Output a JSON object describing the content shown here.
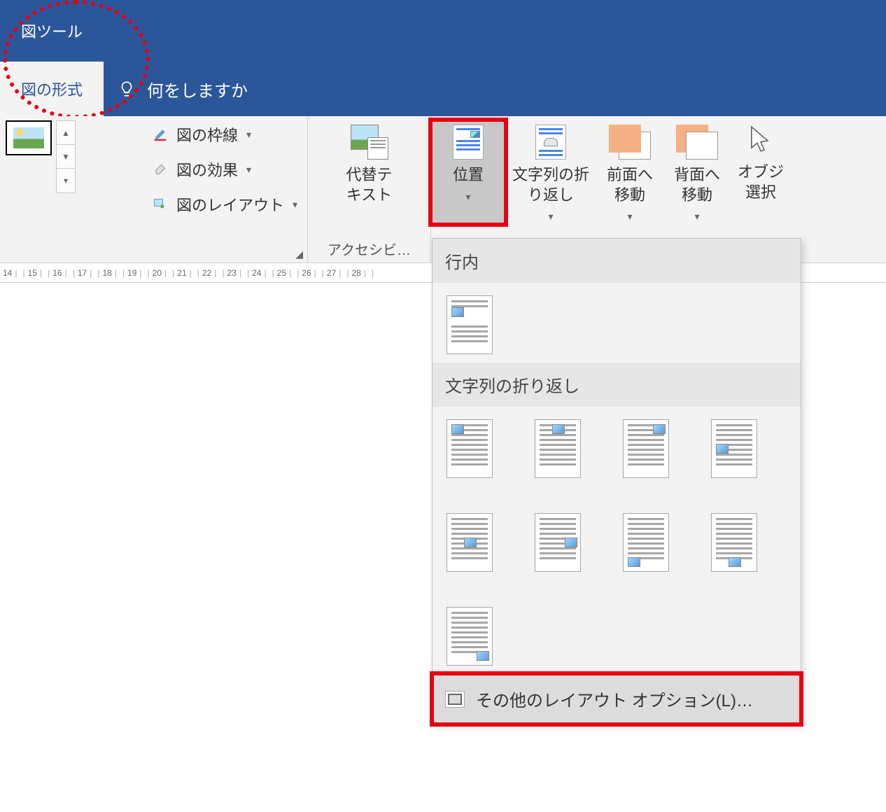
{
  "titleTab": {
    "toolLabel": "図ツール",
    "formatLabel": "図の形式"
  },
  "tellMe": {
    "placeholder": "何をしますか"
  },
  "styleMenu": {
    "border": "図の枠線",
    "effects": "図の効果",
    "layout": "図のレイアウト"
  },
  "altText": {
    "label": "代替テ\nキスト"
  },
  "accessibilityGroup": "アクセシビ…",
  "arrange": {
    "position": "位置",
    "wrap": "文字列の折\nり返し",
    "bringForward": "前面へ\n移動",
    "sendBackward": "背面へ\n移動",
    "selection": "オブジ\n選択"
  },
  "dropdown": {
    "section1": "行内",
    "section2": "文字列の折り返し",
    "moreOptions": "その他のレイアウト オプション(L)…"
  },
  "ruler": [
    "14",
    "15",
    "16",
    "17",
    "18",
    "19",
    "20",
    "21",
    "22",
    "23",
    "24",
    "25",
    "26",
    "27",
    "28"
  ]
}
